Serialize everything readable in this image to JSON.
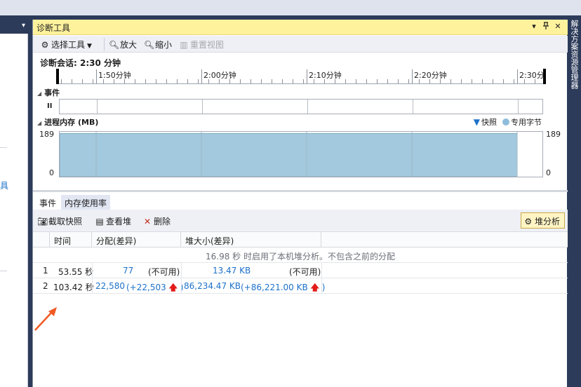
{
  "left_panel": {
    "arrow": "▾",
    "char": "具"
  },
  "right_strip": {
    "text": "解决方案资源管理器"
  },
  "window": {
    "title": "诊断工具",
    "buttons": {
      "dropdown": "▾",
      "pin": "ꟷ",
      "close": "✕"
    }
  },
  "toolbar": {
    "select_tools": "选择工具",
    "zoom_in": "放大",
    "zoom_out": "缩小",
    "reset_view": "重置视图"
  },
  "session": {
    "label": "诊断会话: 2:30 分钟"
  },
  "ruler": {
    "labels": [
      "1:50分钟",
      "2:00分钟",
      "2:10分钟",
      "2:20分钟",
      "2:30分"
    ]
  },
  "events_section": {
    "title": "事件",
    "pause_icon": "II"
  },
  "memory_section": {
    "title": "进程内存 (MB)",
    "legend": {
      "snapshot": "快照",
      "private_bytes": "专用字节"
    },
    "y_max": "189",
    "y_min": "0"
  },
  "chart_data": {
    "type": "area",
    "title": "进程内存 (MB)",
    "ylim": [
      0,
      189
    ],
    "x_ticks": [
      "1:50分钟",
      "2:00分钟",
      "2:10分钟",
      "2:20分钟",
      "2:30分"
    ],
    "series": [
      {
        "name": "专用字节",
        "values": [
          182,
          182,
          182,
          182,
          182,
          182
        ]
      }
    ],
    "color": "#a3c9de"
  },
  "tabs": [
    {
      "label": "事件",
      "active": false
    },
    {
      "label": "内存使用率",
      "active": true
    }
  ],
  "memory_toolbar": {
    "take_snapshot": "截取快照",
    "view_heap": "查看堆",
    "delete": "删除",
    "heap_analysis": "堆分析"
  },
  "table": {
    "headers": [
      "时间",
      "分配(差异)",
      "堆大小(差异)"
    ],
    "notice": "16.98 秒 时启用了本机堆分析。不包含之前的分配",
    "rows": [
      {
        "id": "1",
        "time": "53.55 秒",
        "alloc": "77",
        "alloc_diff": "(不可用)",
        "heap": "13.47 KB",
        "heap_diff": "(不可用)"
      },
      {
        "id": "2",
        "time": "103.42 秒",
        "alloc": "22,580",
        "alloc_diff": "(+22,503",
        "heap": "86,234.47 KB",
        "heap_diff": "(+86,221.00 KB"
      }
    ]
  },
  "colors": {
    "title_bar": "#fff29d",
    "link_blue": "#1c71c9",
    "increase_arrow": "#e31b1b",
    "chart_fill": "#a3c9de",
    "annotation": "#f05a22"
  }
}
